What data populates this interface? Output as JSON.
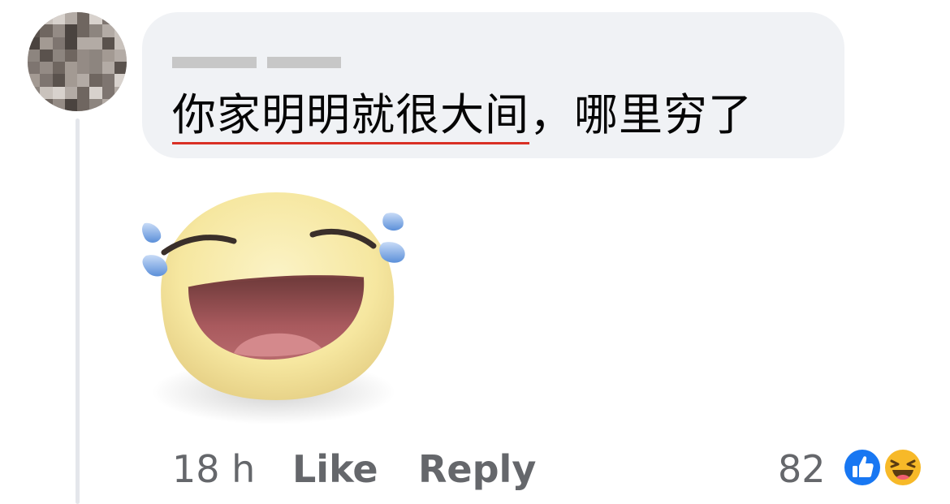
{
  "comment": {
    "author": "",
    "text_underlined": "你家明明就很大间",
    "text_rest": "，哪里穷了"
  },
  "sticker": {
    "icon": "laughing-tears-emoji"
  },
  "footer": {
    "timestamp": "18 h",
    "like_label": "Like",
    "reply_label": "Reply",
    "reaction_count": "82",
    "reaction_icons": [
      "like-icon",
      "haha-icon"
    ]
  },
  "colors": {
    "bubble": "#f0f2f5",
    "text": "#050505",
    "secondary_text": "#65676b",
    "underline": "#d93025",
    "like_blue": "#1877f2",
    "haha_yellow": "#f7b928"
  }
}
